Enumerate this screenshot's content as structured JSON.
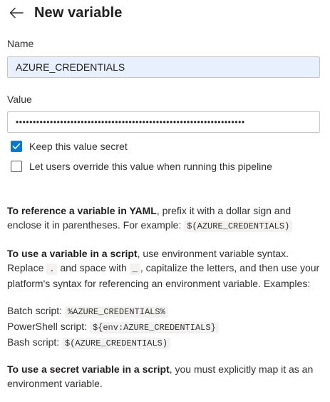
{
  "header": {
    "title": "New variable",
    "back_icon": "arrow-left-icon"
  },
  "name": {
    "label": "Name",
    "value": "AZURE_CREDENTIALS"
  },
  "value": {
    "label": "Value",
    "masked_value": "•••••••••••••••••••••••••••••••••••••••••••••••••••••••••••••••••••"
  },
  "options": {
    "keep_secret": {
      "label": "Keep this value secret",
      "checked": true
    },
    "allow_override": {
      "label": "Let users override this value when running this pipeline",
      "checked": false
    }
  },
  "help": {
    "yaml": {
      "strong": "To reference a variable in YAML",
      "text": ", prefix it with a dollar sign and enclose it in parentheses. For example: ",
      "code": "$(AZURE_CREDENTIALS)"
    },
    "script": {
      "strong": "To use a variable in a script",
      "text1": ", use environment variable syntax. Replace ",
      "code_dot": ".",
      "text2": " and space with ",
      "code_underscore": "_",
      "text3": ", capitalize the letters, and then use your platform's syntax for referencing an environment variable. Examples:"
    },
    "examples": [
      {
        "label": "Batch script: ",
        "code": "%AZURE_CREDENTIALS%"
      },
      {
        "label": "PowerShell script: ",
        "code": "${env:AZURE_CREDENTIALS}"
      },
      {
        "label": "Bash script: ",
        "code": "$(AZURE_CREDENTIALS)"
      }
    ],
    "secret": {
      "strong": "To use a secret variable in a script",
      "text": ", you must explicitly map it as an environment variable."
    }
  },
  "colors": {
    "accent": "#0078d4",
    "autofill_bg": "#e8f0fe"
  }
}
